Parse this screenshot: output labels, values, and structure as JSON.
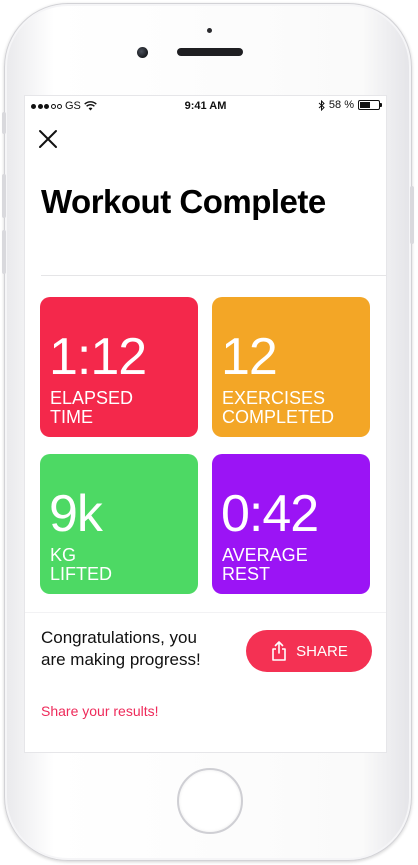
{
  "status_bar": {
    "carrier": "GS",
    "time": "9:41 AM",
    "battery": "58 %",
    "battery_level": 0.58
  },
  "header": {
    "close_icon": "close-icon",
    "title": "Workout Complete"
  },
  "stats": [
    {
      "value": "1:12",
      "label": "ELAPSED TIME",
      "color": "#f4284b"
    },
    {
      "value": "12",
      "label": "EXERCISES COMPLETED",
      "color": "#f3a626"
    },
    {
      "value": "9k",
      "label": "KG LIFTED",
      "color": "#4dd964"
    },
    {
      "value": "0:42",
      "label": "AVERAGE REST",
      "color": "#9b14f5"
    }
  ],
  "footer": {
    "message": "Congratulations, you are making progress!",
    "share_link": "Share your results!",
    "share_button": "SHARE",
    "share_icon": "share-icon"
  }
}
